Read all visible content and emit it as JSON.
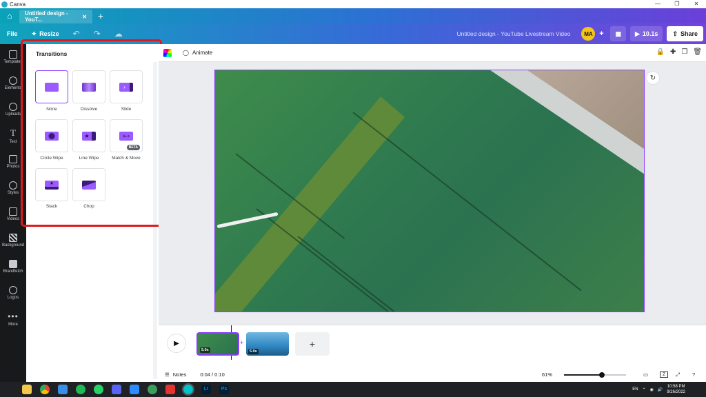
{
  "window": {
    "title": "Canva"
  },
  "tabs": [
    {
      "label": "Untitled design - YouT..."
    }
  ],
  "toolbar": {
    "file": "File",
    "resize": "Resize",
    "doc_title": "Untitled design - YouTube Livestream Video",
    "avatar": "MA",
    "duration": "10.1s",
    "share": "Share"
  },
  "sidebar": {
    "items": [
      {
        "label": "Templates",
        "icon": "template-icon"
      },
      {
        "label": "Elements",
        "icon": "elements-icon"
      },
      {
        "label": "Uploads",
        "icon": "upload-icon"
      },
      {
        "label": "Text",
        "icon": "text-icon"
      },
      {
        "label": "Photos",
        "icon": "photo-icon"
      },
      {
        "label": "Styles",
        "icon": "styles-icon"
      },
      {
        "label": "Videos",
        "icon": "video-icon"
      },
      {
        "label": "Background",
        "icon": "background-icon"
      },
      {
        "label": "Brandfetch",
        "icon": "brandfetch-icon"
      },
      {
        "label": "Logos",
        "icon": "logos-icon"
      },
      {
        "label": "More",
        "icon": "more-icon"
      }
    ]
  },
  "panel": {
    "title": "Transitions",
    "items": [
      {
        "label": "None"
      },
      {
        "label": "Dissolve"
      },
      {
        "label": "Slide"
      },
      {
        "label": "Circle Wipe"
      },
      {
        "label": "Line Wipe"
      },
      {
        "label": "Match & Move",
        "badge": "BETA"
      },
      {
        "label": "Stack"
      },
      {
        "label": "Chop"
      }
    ]
  },
  "context_bar": {
    "animate": "Animate"
  },
  "timeline": {
    "clips": [
      {
        "duration": "5.0s"
      },
      {
        "duration": "5.0s"
      }
    ],
    "add": "+"
  },
  "footer": {
    "notes": "Notes",
    "time": "0:04 / 0:10",
    "zoom": "61%",
    "zoom_fraction": 0.61,
    "page_count": "2"
  },
  "system": {
    "lang": "EN",
    "time": "10:58 PM",
    "date": "9/26/2022"
  },
  "colors": {
    "accent": "#8b3dff",
    "highlight": "#e0171f"
  }
}
